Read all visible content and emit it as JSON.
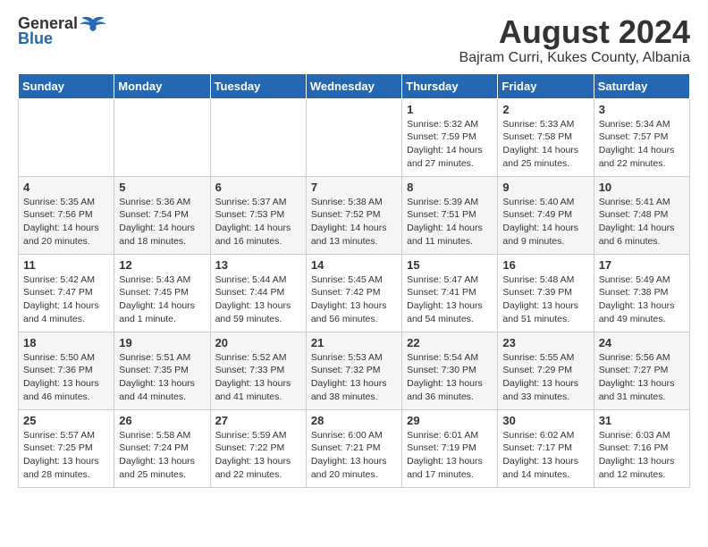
{
  "logo": {
    "general": "General",
    "blue": "Blue"
  },
  "title": {
    "month_year": "August 2024",
    "location": "Bajram Curri, Kukes County, Albania"
  },
  "weekdays": [
    "Sunday",
    "Monday",
    "Tuesday",
    "Wednesday",
    "Thursday",
    "Friday",
    "Saturday"
  ],
  "weeks": [
    [
      {
        "day": "",
        "info": ""
      },
      {
        "day": "",
        "info": ""
      },
      {
        "day": "",
        "info": ""
      },
      {
        "day": "",
        "info": ""
      },
      {
        "day": "1",
        "info": "Sunrise: 5:32 AM\nSunset: 7:59 PM\nDaylight: 14 hours and 27 minutes."
      },
      {
        "day": "2",
        "info": "Sunrise: 5:33 AM\nSunset: 7:58 PM\nDaylight: 14 hours and 25 minutes."
      },
      {
        "day": "3",
        "info": "Sunrise: 5:34 AM\nSunset: 7:57 PM\nDaylight: 14 hours and 22 minutes."
      }
    ],
    [
      {
        "day": "4",
        "info": "Sunrise: 5:35 AM\nSunset: 7:56 PM\nDaylight: 14 hours and 20 minutes."
      },
      {
        "day": "5",
        "info": "Sunrise: 5:36 AM\nSunset: 7:54 PM\nDaylight: 14 hours and 18 minutes."
      },
      {
        "day": "6",
        "info": "Sunrise: 5:37 AM\nSunset: 7:53 PM\nDaylight: 14 hours and 16 minutes."
      },
      {
        "day": "7",
        "info": "Sunrise: 5:38 AM\nSunset: 7:52 PM\nDaylight: 14 hours and 13 minutes."
      },
      {
        "day": "8",
        "info": "Sunrise: 5:39 AM\nSunset: 7:51 PM\nDaylight: 14 hours and 11 minutes."
      },
      {
        "day": "9",
        "info": "Sunrise: 5:40 AM\nSunset: 7:49 PM\nDaylight: 14 hours and 9 minutes."
      },
      {
        "day": "10",
        "info": "Sunrise: 5:41 AM\nSunset: 7:48 PM\nDaylight: 14 hours and 6 minutes."
      }
    ],
    [
      {
        "day": "11",
        "info": "Sunrise: 5:42 AM\nSunset: 7:47 PM\nDaylight: 14 hours and 4 minutes."
      },
      {
        "day": "12",
        "info": "Sunrise: 5:43 AM\nSunset: 7:45 PM\nDaylight: 14 hours and 1 minute."
      },
      {
        "day": "13",
        "info": "Sunrise: 5:44 AM\nSunset: 7:44 PM\nDaylight: 13 hours and 59 minutes."
      },
      {
        "day": "14",
        "info": "Sunrise: 5:45 AM\nSunset: 7:42 PM\nDaylight: 13 hours and 56 minutes."
      },
      {
        "day": "15",
        "info": "Sunrise: 5:47 AM\nSunset: 7:41 PM\nDaylight: 13 hours and 54 minutes."
      },
      {
        "day": "16",
        "info": "Sunrise: 5:48 AM\nSunset: 7:39 PM\nDaylight: 13 hours and 51 minutes."
      },
      {
        "day": "17",
        "info": "Sunrise: 5:49 AM\nSunset: 7:38 PM\nDaylight: 13 hours and 49 minutes."
      }
    ],
    [
      {
        "day": "18",
        "info": "Sunrise: 5:50 AM\nSunset: 7:36 PM\nDaylight: 13 hours and 46 minutes."
      },
      {
        "day": "19",
        "info": "Sunrise: 5:51 AM\nSunset: 7:35 PM\nDaylight: 13 hours and 44 minutes."
      },
      {
        "day": "20",
        "info": "Sunrise: 5:52 AM\nSunset: 7:33 PM\nDaylight: 13 hours and 41 minutes."
      },
      {
        "day": "21",
        "info": "Sunrise: 5:53 AM\nSunset: 7:32 PM\nDaylight: 13 hours and 38 minutes."
      },
      {
        "day": "22",
        "info": "Sunrise: 5:54 AM\nSunset: 7:30 PM\nDaylight: 13 hours and 36 minutes."
      },
      {
        "day": "23",
        "info": "Sunrise: 5:55 AM\nSunset: 7:29 PM\nDaylight: 13 hours and 33 minutes."
      },
      {
        "day": "24",
        "info": "Sunrise: 5:56 AM\nSunset: 7:27 PM\nDaylight: 13 hours and 31 minutes."
      }
    ],
    [
      {
        "day": "25",
        "info": "Sunrise: 5:57 AM\nSunset: 7:25 PM\nDaylight: 13 hours and 28 minutes."
      },
      {
        "day": "26",
        "info": "Sunrise: 5:58 AM\nSunset: 7:24 PM\nDaylight: 13 hours and 25 minutes."
      },
      {
        "day": "27",
        "info": "Sunrise: 5:59 AM\nSunset: 7:22 PM\nDaylight: 13 hours and 22 minutes."
      },
      {
        "day": "28",
        "info": "Sunrise: 6:00 AM\nSunset: 7:21 PM\nDaylight: 13 hours and 20 minutes."
      },
      {
        "day": "29",
        "info": "Sunrise: 6:01 AM\nSunset: 7:19 PM\nDaylight: 13 hours and 17 minutes."
      },
      {
        "day": "30",
        "info": "Sunrise: 6:02 AM\nSunset: 7:17 PM\nDaylight: 13 hours and 14 minutes."
      },
      {
        "day": "31",
        "info": "Sunrise: 6:03 AM\nSunset: 7:16 PM\nDaylight: 13 hours and 12 minutes."
      }
    ]
  ]
}
